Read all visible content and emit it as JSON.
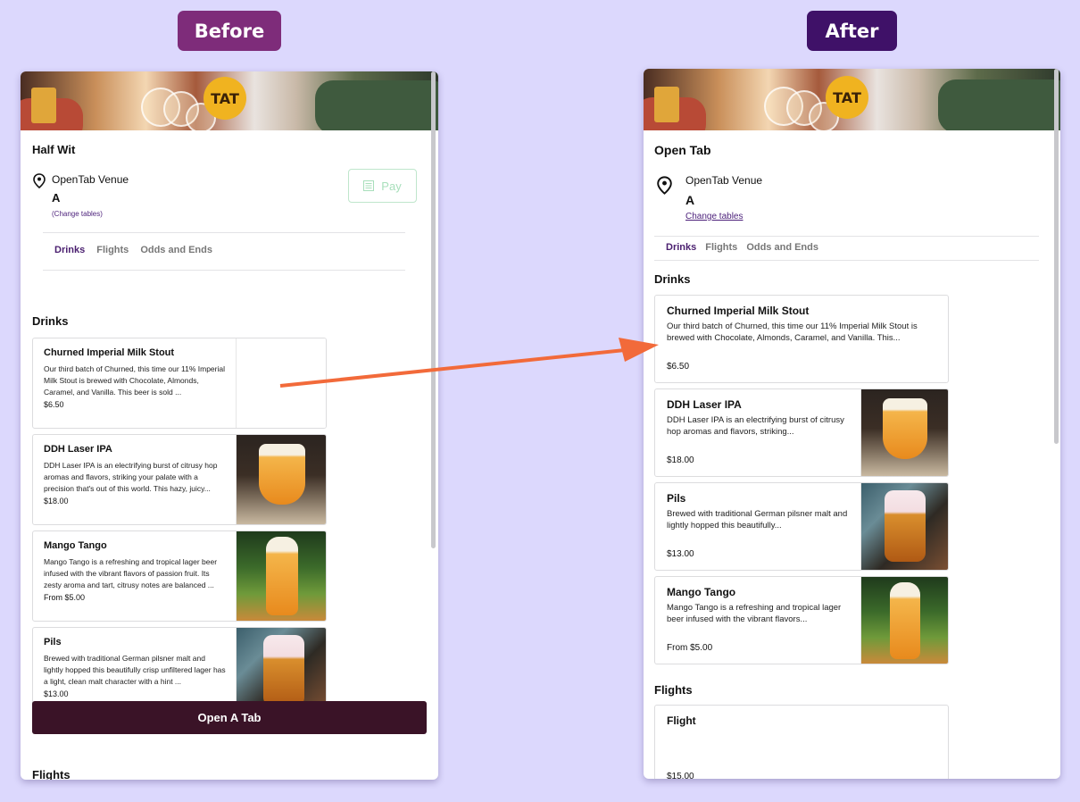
{
  "labels": {
    "before": "Before",
    "after": "After"
  },
  "colors": {
    "accent": "#4a1f6f",
    "arrow": "#f26a3a",
    "open_tab_bg": "#3a1327",
    "pay_green": "#a8dfbb"
  },
  "before": {
    "venue_title": "Half Wit",
    "venue_name": "OpenTab Venue",
    "table": "A",
    "change_tables": "(Change tables)",
    "pay_label": "Pay",
    "tabs": [
      "Drinks",
      "Flights",
      "Odds and Ends"
    ],
    "active_tab": "Drinks",
    "section_drinks": "Drinks",
    "section_flights": "Flights",
    "items": [
      {
        "name": "Churned Imperial Milk Stout",
        "desc": "Our third batch of Churned, this time our 11% Imperial Milk Stout is brewed with Chocolate, Almonds, Caramel, and Vanilla. This beer is sold ...",
        "price": "$6.50"
      },
      {
        "name": "DDH Laser IPA",
        "desc": "DDH Laser IPA is an electrifying burst of citrusy hop aromas and flavors, striking your palate with a precision that's out of this world. This hazy, juicy...",
        "price": "$18.00"
      },
      {
        "name": "Mango Tango",
        "desc": "Mango Tango is a refreshing and tropical lager beer infused with the vibrant flavors of passion fruit. Its zesty aroma and tart, citrusy notes are balanced ...",
        "price": "From $5.00"
      },
      {
        "name": "Pils",
        "desc": "Brewed with traditional German pilsner malt and lightly hopped this beautifully crisp unfiltered lager has a light, clean malt character with a hint ...",
        "price": "$13.00"
      }
    ],
    "open_tab_label": "Open A Tab"
  },
  "after": {
    "venue_title": "Open Tab",
    "venue_name": "OpenTab Venue",
    "table": "A",
    "change_tables": "Change tables",
    "tabs": [
      "Drinks",
      "Flights",
      "Odds and Ends"
    ],
    "active_tab": "Drinks",
    "section_drinks": "Drinks",
    "section_flights": "Flights",
    "items": [
      {
        "name": "Churned Imperial Milk Stout",
        "desc": "Our third batch of Churned, this time our 11% Imperial Milk Stout is brewed with Chocolate, Almonds, Caramel, and Vanilla. This...",
        "price": "$6.50"
      },
      {
        "name": "DDH Laser IPA",
        "desc": "DDH Laser IPA is an electrifying burst of citrusy hop aromas and flavors, striking...",
        "price": "$18.00"
      },
      {
        "name": "Pils",
        "desc": "Brewed with traditional German pilsner malt and lightly hopped this beautifully...",
        "price": "$13.00"
      },
      {
        "name": "Mango Tango",
        "desc": "Mango Tango is a refreshing and tropical lager beer infused with the vibrant flavors...",
        "price": "From $5.00"
      }
    ],
    "flight": {
      "name": "Flight",
      "price": "$15.00"
    }
  },
  "hero_logo": "TAT"
}
